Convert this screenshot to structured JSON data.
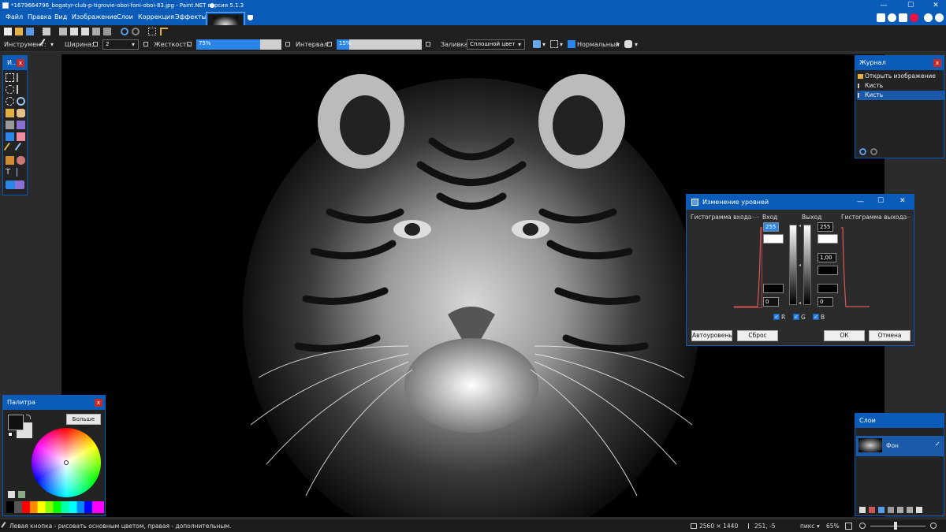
{
  "window": {
    "title": "*1679664796_bogatyr-club-p-tigrovie-oboi-foni-oboi-83.jpg - Paint.NET версия 5.1.3",
    "minimize": "—",
    "maximize": "☐",
    "close": "✕"
  },
  "menu": [
    "Файл",
    "Правка",
    "Вид",
    "Изображение",
    "Слои",
    "Коррекция",
    "Эффекты"
  ],
  "toolbar2": {
    "tool_label": "Инструмент:",
    "width_label": "Ширина:",
    "width_value": "2",
    "hardness_label": "Жесткость:",
    "hardness_value": "75%",
    "hardness_fraction": 0.75,
    "interval_label": "Интервал:",
    "interval_value": "15%",
    "interval_fraction": 0.15,
    "fill_label": "Заливка:",
    "fill_value": "Сплошной цвет",
    "blend_value": "Нормальный"
  },
  "tools_panel": {
    "title": "И..."
  },
  "history_panel": {
    "title": "Журнал",
    "items": [
      {
        "label": "Открыть изображение",
        "selected": false
      },
      {
        "label": "Кисть",
        "selected": false
      },
      {
        "label": "Кисть",
        "selected": true
      }
    ]
  },
  "palette_panel": {
    "title": "Палитра",
    "more_button": "Больше >>",
    "primary_color": "#111111",
    "secondary_color": "#e0e0e0"
  },
  "layers_panel": {
    "title": "Слои",
    "layers": [
      {
        "name": "Фон",
        "visible": true
      }
    ]
  },
  "levels_dialog": {
    "title": "Изменение уровней",
    "input_histogram_label": "Гистограмма входа",
    "input_label": "Вход",
    "output_label": "Выход",
    "output_histogram_label": "Гистограмма выхода",
    "input_high": "255",
    "input_low": "0",
    "output_high": "255",
    "output_gamma": "1,00",
    "output_low": "0",
    "channels": [
      {
        "label": "R",
        "checked": true
      },
      {
        "label": "G",
        "checked": true
      },
      {
        "label": "B",
        "checked": true
      }
    ],
    "auto_button": "Автоуровень",
    "reset_button": "Сброс",
    "ok_button": "ОК",
    "cancel_button": "Отмена"
  },
  "status": {
    "hint": "Левая кнопка - рисовать основным цветом, правая - дополнительным.",
    "image_size": "2560 × 1440",
    "cursor_pos": "251, -5",
    "units": "пикс",
    "zoom": "65%"
  },
  "colors": {
    "accent": "#0a5cb8",
    "panel_bg": "#232323",
    "close_red": "#c42b2b"
  }
}
